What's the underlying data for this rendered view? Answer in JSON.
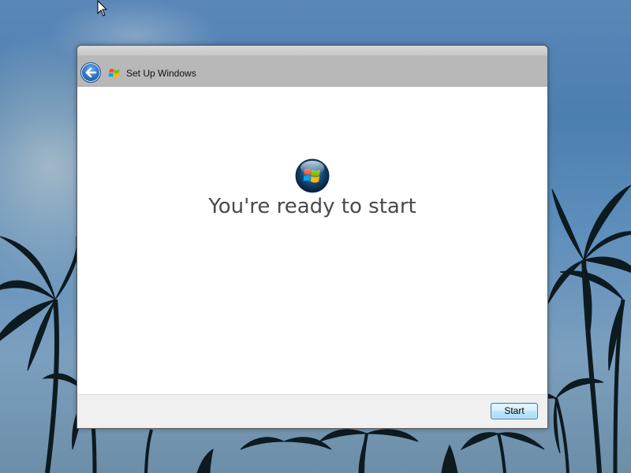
{
  "window": {
    "title": "Set Up Windows",
    "back_icon": "back-arrow-icon",
    "title_icon": "windows-flag-icon"
  },
  "main": {
    "logo_icon": "windows-orb-icon",
    "heading": "You're ready to start"
  },
  "footer": {
    "start_label": "Start"
  },
  "colors": {
    "title_bar": "#b8b8b8",
    "heading_text": "#4a4a4a",
    "button_accent": "#3c7fb1"
  }
}
